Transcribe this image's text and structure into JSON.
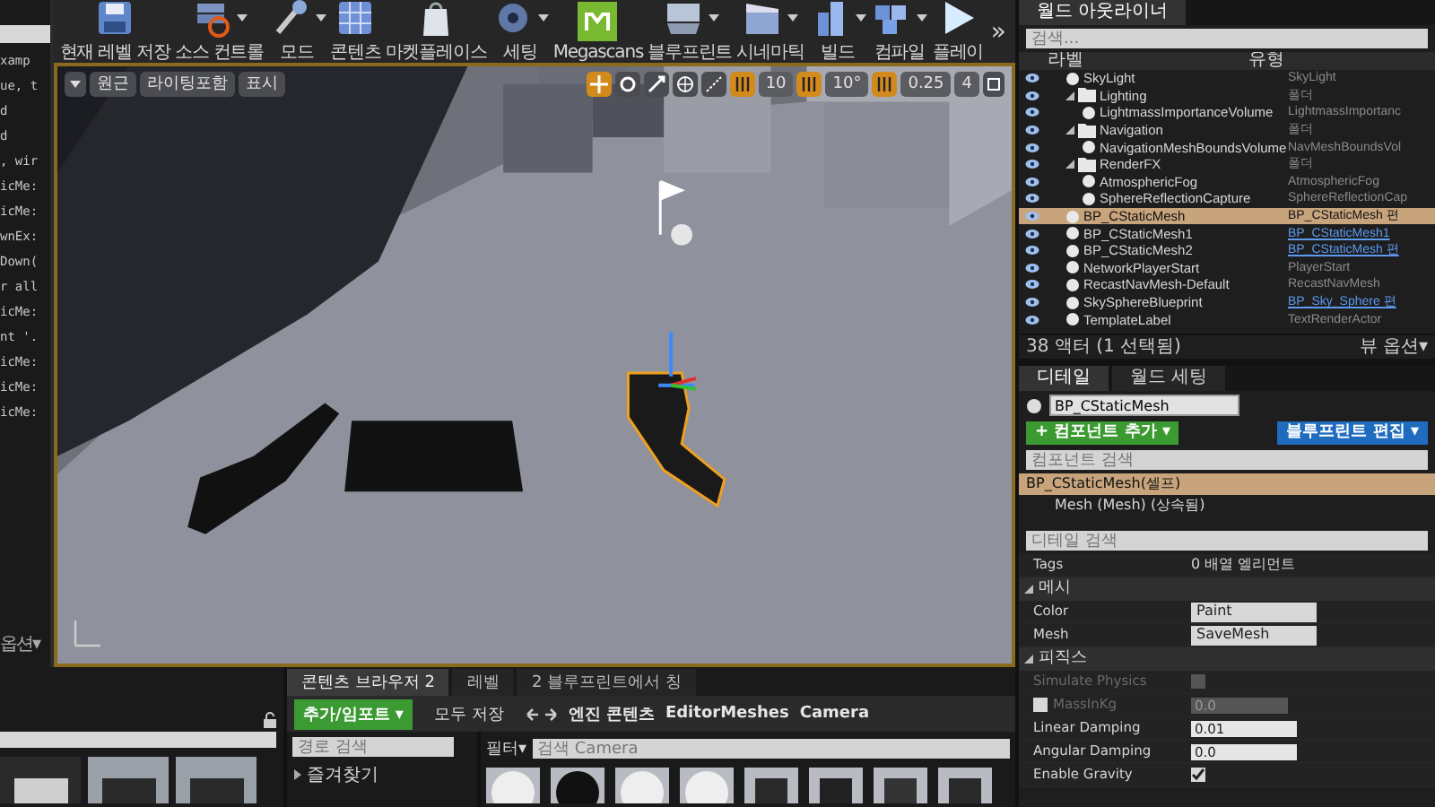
{
  "log_panel": {
    "lines": [
      "xamp",
      "ue, t",
      "d",
      "d",
      ", wir",
      "icMe:",
      "icMe:",
      "wnEx:",
      "Down(",
      "r all",
      "icMe:",
      "nt '.",
      "icMe:",
      "icMe:",
      "icMe:"
    ],
    "view_options": "옵션▾"
  },
  "toolbar": {
    "buttons": [
      {
        "label": "현재 레벨 저장",
        "has_menu": false
      },
      {
        "label": "소스 컨트롤",
        "has_menu": true
      },
      {
        "label": "모드",
        "has_menu": true
      },
      {
        "label": "콘텐츠",
        "has_menu": false
      },
      {
        "label": "마켓플레이스",
        "has_menu": false
      },
      {
        "label": "세팅",
        "has_menu": true
      },
      {
        "label": "Megascans",
        "has_menu": false
      },
      {
        "label": "블루프린트",
        "has_menu": true
      },
      {
        "label": "시네마틱",
        "has_menu": true
      },
      {
        "label": "빌드",
        "has_menu": true
      },
      {
        "label": "컴파일",
        "has_menu": true
      },
      {
        "label": "플레이",
        "has_menu": false
      }
    ],
    "overflow": "»"
  },
  "viewport": {
    "left_buttons": [
      "원근",
      "라이팅포함",
      "표시"
    ],
    "transform_modes": [
      {
        "selected": true
      },
      {
        "selected": false
      },
      {
        "selected": false
      }
    ],
    "snaps": [
      {
        "value": "10",
        "on": true
      },
      {
        "value": "10°",
        "on": true
      },
      {
        "value": "0.25",
        "on": true
      }
    ],
    "camera_speed": "4"
  },
  "outliner": {
    "tab": "월드 아웃라이너",
    "search": {
      "placeholder": "검색..."
    },
    "columns": [
      "라벨",
      "유형"
    ],
    "rows": [
      {
        "label": "SkyLight",
        "type": "SkyLight",
        "type_link": false,
        "selected": false
      },
      {
        "label": "Lighting",
        "type": "폴더",
        "type_link": false,
        "selected": false,
        "expanded": true,
        "children": [
          {
            "label": "LightmassImportanceVolume",
            "type": "LightmassImportanc",
            "type_link": false,
            "selected": false
          }
        ]
      },
      {
        "label": "Navigation",
        "type": "폴더",
        "type_link": false,
        "selected": false,
        "expanded": true,
        "children": [
          {
            "label": "NavigationMeshBoundsVolume",
            "type": "NavMeshBoundsVol",
            "type_link": false,
            "selected": false
          }
        ]
      },
      {
        "label": "RenderFX",
        "type": "폴더",
        "type_link": false,
        "selected": false,
        "expanded": true,
        "children": [
          {
            "label": "AtmosphericFog",
            "type": "AtmosphericFog",
            "type_link": false,
            "selected": false
          },
          {
            "label": "SphereReflectionCapture",
            "type": "SphereReflectionCap",
            "type_link": false,
            "selected": false
          }
        ]
      },
      {
        "label": "BP_CStaticMesh",
        "type": "BP_CStaticMesh 편",
        "type_link": false,
        "selected": true
      },
      {
        "label": "BP_CStaticMesh1",
        "type": "BP_CStaticMesh1",
        "type_link": true,
        "selected": false
      },
      {
        "label": "BP_CStaticMesh2",
        "type": "BP_CStaticMesh 편",
        "type_link": true,
        "selected": false
      },
      {
        "label": "NetworkPlayerStart",
        "type": "PlayerStart",
        "type_link": false,
        "selected": false
      },
      {
        "label": "RecastNavMesh-Default",
        "type": "RecastNavMesh",
        "type_link": false,
        "selected": false
      },
      {
        "label": "SkySphereBlueprint",
        "type": "BP_Sky_Sphere 편",
        "type_link": true,
        "selected": false
      },
      {
        "label": "TemplateLabel",
        "type": "TextRenderActor",
        "type_link": false,
        "selected": false
      }
    ],
    "footer": "38 액터 (1 선택됨)",
    "view_options": "뷰 옵션▾"
  },
  "details": {
    "tabs": [
      {
        "label": "디테일",
        "selected": true
      },
      {
        "label": "월드 세팅",
        "selected": false
      }
    ],
    "name": "BP_CStaticMesh",
    "add_component": "+ 컴포넌트 추가 ▾",
    "edit_blueprint": "블루프린트 편집 ▾",
    "component_search": {
      "placeholder": "컴포넌트 검색"
    },
    "components": [
      {
        "label": "BP_CStaticMesh(셀프)",
        "selected": true,
        "children": [
          {
            "label": "Mesh (Mesh) (상속됨)",
            "selected": false
          }
        ]
      }
    ],
    "detail_search": {
      "placeholder": "디테일 검색"
    },
    "tags": {
      "label": "Tags",
      "value": "0 배열 엘리먼트"
    },
    "sections": [
      {
        "title": "메시",
        "expanded": true,
        "rows": [
          {
            "kind": "button",
            "label": "Color",
            "value": "Paint"
          },
          {
            "kind": "button",
            "label": "Mesh",
            "value": "SaveMesh"
          }
        ]
      },
      {
        "title": "피직스",
        "expanded": true,
        "rows": [
          {
            "kind": "checkbox",
            "label": "Simulate Physics",
            "checked": false,
            "disabled": true
          },
          {
            "kind": "checkbox_field",
            "label": "MassInKg",
            "checked": false,
            "value": "0.0",
            "disabled": true
          },
          {
            "kind": "number",
            "label": "Linear Damping",
            "value": "0.01",
            "disabled": false
          },
          {
            "kind": "number",
            "label": "Angular Damping",
            "value": "0.0",
            "disabled": false
          },
          {
            "kind": "checkbox",
            "label": "Enable Gravity",
            "checked": true,
            "disabled": false
          }
        ]
      }
    ]
  },
  "content_browser": {
    "tabs": [
      {
        "label": "콘텐츠 브라우저 2",
        "selected": true
      },
      {
        "label": "레벨",
        "selected": false
      },
      {
        "label": "2 블루프린트에서 칭",
        "selected": false
      }
    ],
    "add_import": "추가/임포트 ▾",
    "save_all": "모두 저장",
    "breadcrumb": [
      "엔진 콘텐츠",
      "EditorMeshes",
      "Camera"
    ],
    "path_search": {
      "placeholder": "경로 검색"
    },
    "tree": [
      {
        "label": "즐겨찾기",
        "expanded": false
      }
    ],
    "filter": "필터▾",
    "asset_search": {
      "placeholder": "검색 Camera"
    }
  }
}
